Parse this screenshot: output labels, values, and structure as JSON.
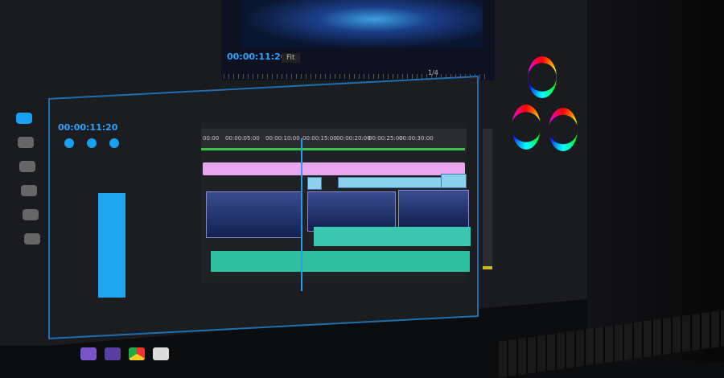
{
  "program_monitor": {
    "timecode": "00:00:11:20",
    "zoom": "Fit",
    "resolution": "1/4"
  },
  "sequence": {
    "timecode": "00:00:11:20"
  },
  "timeline": {
    "ruler_ticks": [
      "00:00",
      "00:00:05:00",
      "00:00:10:00",
      "00:00:15:00",
      "00:00:20:00",
      "00:00:25:00",
      "00:00:30:00"
    ]
  },
  "transport_icons": [
    "marker-icon",
    "in-point-icon",
    "out-point-icon",
    "go-to-in-icon",
    "step-back-icon",
    "play-icon",
    "step-forward-icon",
    "go-to-out-icon",
    "lift-icon",
    "extract-icon",
    "export-frame-icon"
  ],
  "colors": {
    "accent": "#2aa3ff",
    "timeline_bar": "#38c24a",
    "title_clip": "#e9a6ee",
    "audio": "#2fbf9f"
  }
}
